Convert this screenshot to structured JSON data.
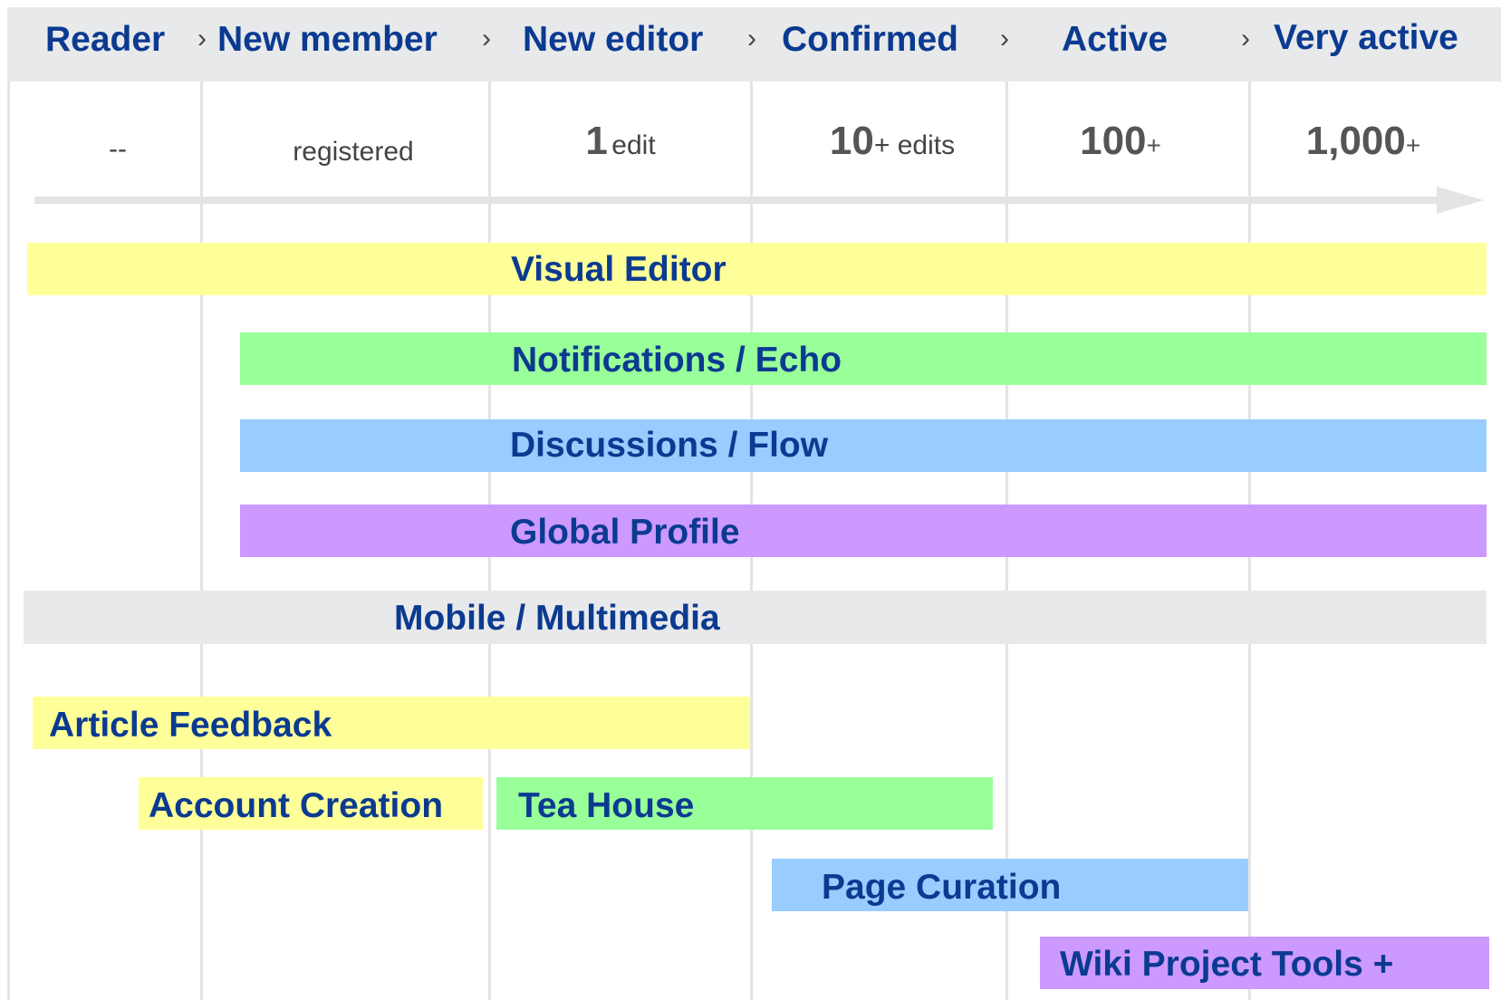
{
  "colors": {
    "header_bg": "#e8e9ea",
    "label_blue": "#0b3a91",
    "yellow": "#ffff99",
    "green": "#99ff99",
    "blue": "#99ccff",
    "purple": "#cc99ff",
    "gray": "#e8e9ea"
  },
  "stages": {
    "reader": "Reader",
    "new_member": "New member",
    "new_editor": "New editor",
    "confirmed": "Confirmed",
    "active": "Active",
    "very_active": "Very active",
    "separator": "›"
  },
  "thresholds": {
    "reader": "--",
    "new_member": "registered",
    "new_editor_num": "1",
    "new_editor_unit": "edit",
    "confirmed_num": "10",
    "confirmed_unit": "+ edits",
    "active_num": "100",
    "active_unit": "+",
    "very_active_num": "1,000",
    "very_active_unit": "+"
  },
  "features": {
    "visual_editor": "Visual Editor",
    "notifications": "Notifications / Echo",
    "discussions": "Discussions / Flow",
    "global_profile": "Global Profile",
    "mobile": "Mobile / Multimedia",
    "article_feedback": "Article Feedback",
    "account_creation": "Account Creation",
    "tea_house": "Tea House",
    "page_curation": "Page Curation",
    "wiki_project_tools": "Wiki Project Tools +"
  }
}
